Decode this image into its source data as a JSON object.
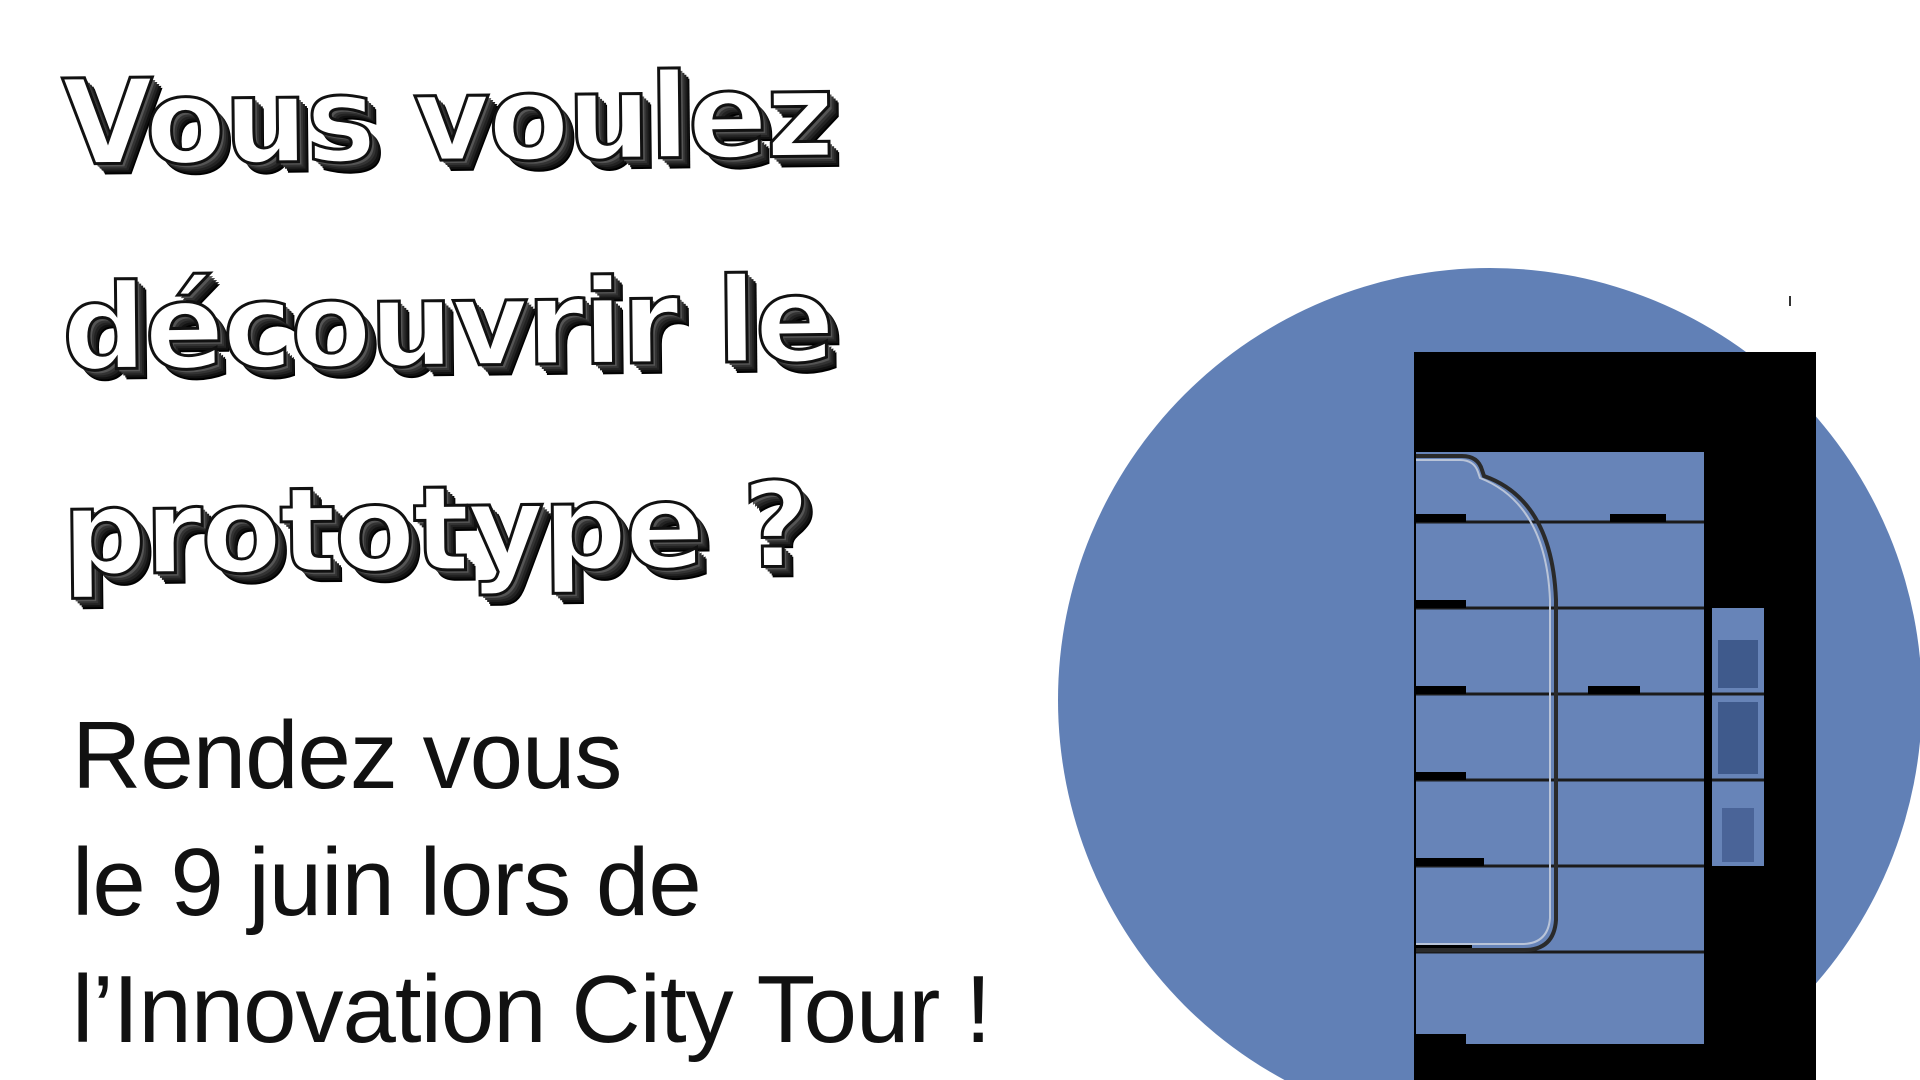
{
  "headline": {
    "line1": "Vous voulez",
    "line2": "découvrir le",
    "line3": "prototype ?"
  },
  "subtext": {
    "line1": "Rendez vous",
    "line2": "le 9 juin lors de",
    "line3": "l’Innovation City Tour !"
  },
  "colors": {
    "background": "#ffffff",
    "circle": "#6180b6",
    "building_frame": "#000000",
    "building_floor": "#6784b8",
    "window_dark": "#3f5a8c",
    "text": "#111111"
  },
  "icons": {
    "illustration": "building-cross-section-icon",
    "circle": "blue-circle-backdrop"
  }
}
